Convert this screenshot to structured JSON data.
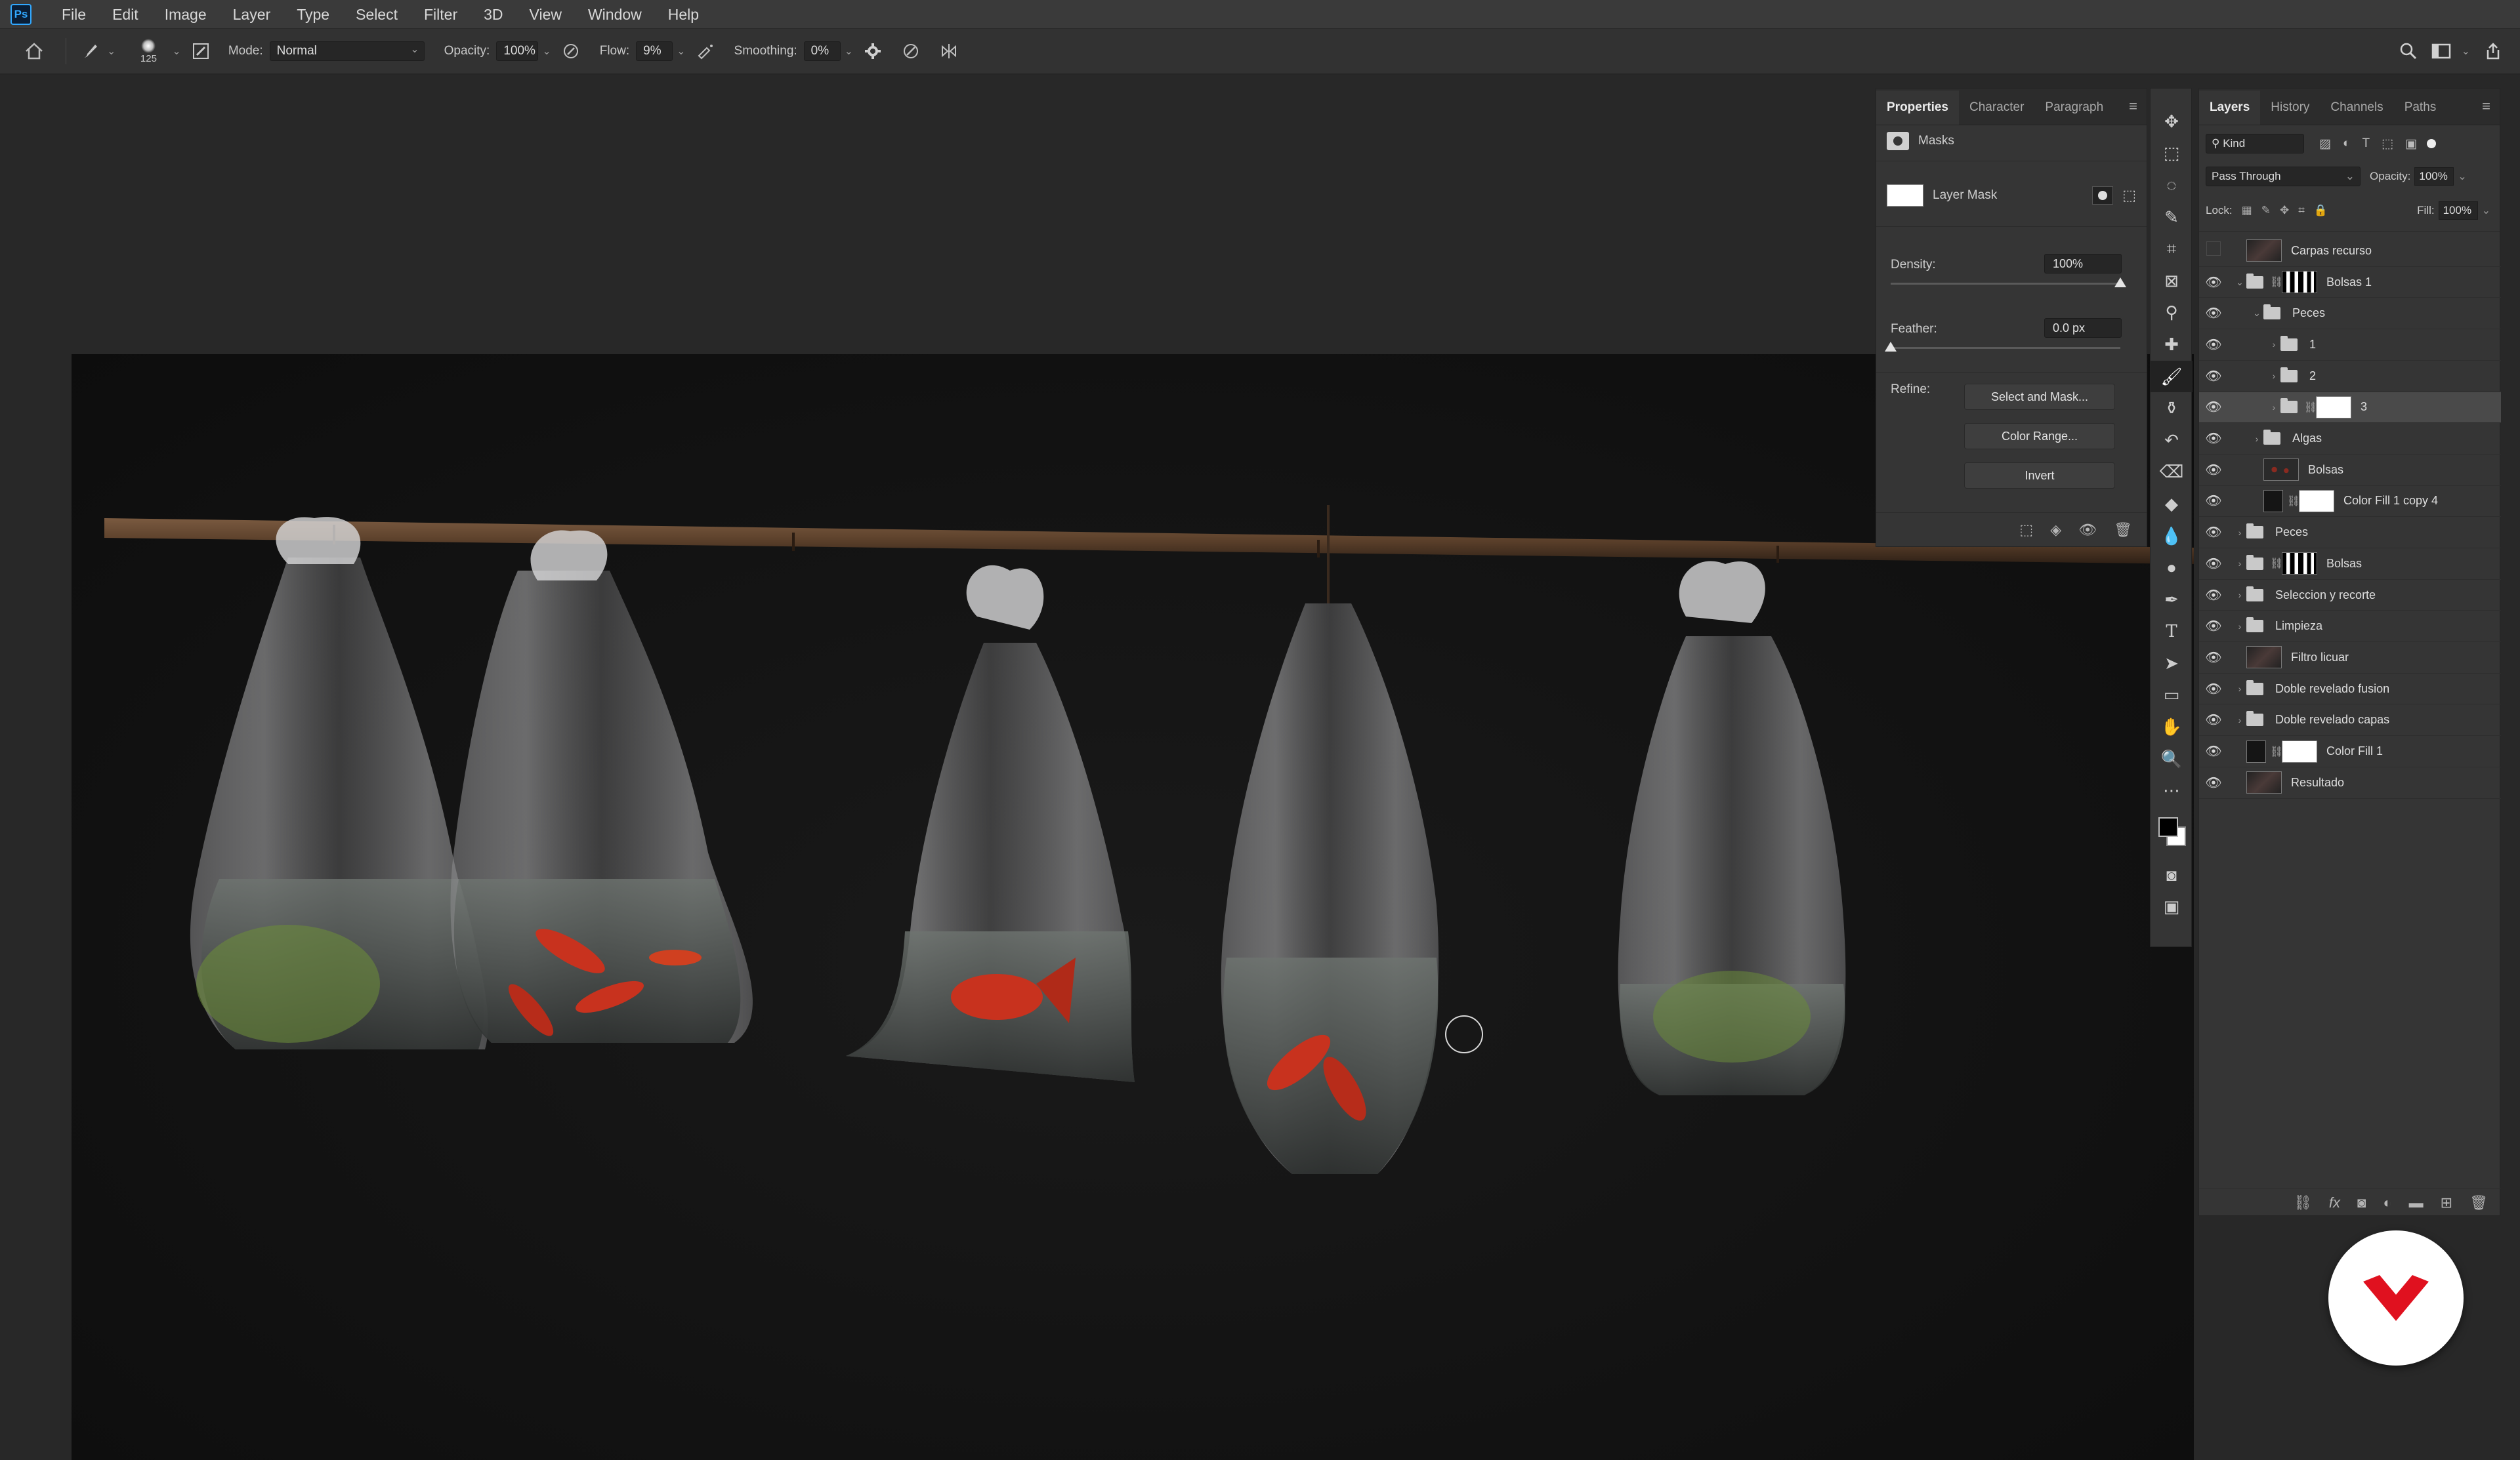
{
  "app": {
    "logo": "Ps"
  },
  "menu": [
    "File",
    "Edit",
    "Image",
    "Layer",
    "Type",
    "Select",
    "Filter",
    "3D",
    "View",
    "Window",
    "Help"
  ],
  "options": {
    "brush_size": "125",
    "mode_label": "Mode:",
    "mode_value": "Normal",
    "opacity_label": "Opacity:",
    "opacity_value": "100%",
    "flow_label": "Flow:",
    "flow_value": "9%",
    "smoothing_label": "Smoothing:",
    "smoothing_value": "0%"
  },
  "properties": {
    "tabs": [
      "Properties",
      "Character",
      "Paragraph"
    ],
    "section": "Masks",
    "mask_label": "Layer Mask",
    "density_label": "Density:",
    "density_value": "100%",
    "density_level": 1.0,
    "feather_label": "Feather:",
    "feather_value": "0.0 px",
    "feather_level": 0.0,
    "refine_label": "Refine:",
    "buttons": [
      "Select and Mask...",
      "Color Range...",
      "Invert"
    ]
  },
  "toolbar": {
    "tools": [
      "move-tool-icon",
      "marquee-tool-icon",
      "lasso-tool-icon",
      "quick-select-tool-icon",
      "crop-tool-icon",
      "frame-tool-icon",
      "eyedropper-tool-icon",
      "healing-brush-tool-icon",
      "brush-tool-icon",
      "clone-stamp-tool-icon",
      "history-brush-tool-icon",
      "eraser-tool-icon",
      "paint-bucket-tool-icon",
      "blur-tool-icon",
      "dodge-tool-icon",
      "pen-tool-icon",
      "type-tool-icon",
      "path-select-tool-icon",
      "rectangle-tool-icon",
      "hand-tool-icon",
      "zoom-tool-icon",
      "more-tools-icon"
    ],
    "active_tool": "brush-tool-icon"
  },
  "layers": {
    "tabs": [
      "Layers",
      "History",
      "Channels",
      "Paths"
    ],
    "filter_kind": "Kind",
    "blend_mode": "Pass Through",
    "opacity_label": "Opacity:",
    "opacity_value": "100%",
    "lock_label": "Lock:",
    "fill_label": "Fill:",
    "fill_value": "100%",
    "rows": [
      {
        "name": "Carpas recurso",
        "visible": false,
        "indent": 0,
        "kind": "image",
        "twisty": ""
      },
      {
        "name": "Bolsas 1",
        "visible": true,
        "indent": 0,
        "kind": "group-mask",
        "twisty": "⌄"
      },
      {
        "name": "Peces",
        "visible": true,
        "indent": 1,
        "kind": "group",
        "twisty": "⌄"
      },
      {
        "name": "1",
        "visible": true,
        "indent": 2,
        "kind": "group",
        "twisty": "›"
      },
      {
        "name": "2",
        "visible": true,
        "indent": 2,
        "kind": "group",
        "twisty": "›"
      },
      {
        "name": "3",
        "visible": true,
        "indent": 2,
        "kind": "group-whitemask",
        "twisty": "›",
        "selected": true
      },
      {
        "name": "Algas",
        "visible": true,
        "indent": 1,
        "kind": "group",
        "twisty": "›"
      },
      {
        "name": "Bolsas",
        "visible": true,
        "indent": 1,
        "kind": "smart",
        "twisty": ""
      },
      {
        "name": "Color Fill 1 copy 4",
        "visible": true,
        "indent": 1,
        "kind": "fill",
        "twisty": ""
      },
      {
        "name": "Peces",
        "visible": true,
        "indent": 0,
        "kind": "group",
        "twisty": "›"
      },
      {
        "name": "Bolsas",
        "visible": true,
        "indent": 0,
        "kind": "group-mask",
        "twisty": "›"
      },
      {
        "name": "Seleccion y recorte",
        "visible": true,
        "indent": 0,
        "kind": "group",
        "twisty": "›"
      },
      {
        "name": "Limpieza",
        "visible": true,
        "indent": 0,
        "kind": "group",
        "twisty": "›"
      },
      {
        "name": "Filtro licuar",
        "visible": true,
        "indent": 0,
        "kind": "image",
        "twisty": ""
      },
      {
        "name": "Doble revelado fusion",
        "visible": true,
        "indent": 0,
        "kind": "group",
        "twisty": "›"
      },
      {
        "name": "Doble revelado capas",
        "visible": true,
        "indent": 0,
        "kind": "group",
        "twisty": "›"
      },
      {
        "name": "Color Fill 1",
        "visible": true,
        "indent": 0,
        "kind": "fill",
        "twisty": ""
      },
      {
        "name": "Resultado",
        "visible": true,
        "indent": 0,
        "kind": "image",
        "twisty": ""
      }
    ]
  },
  "colors": {
    "accent": "#31a8ff",
    "brand_red": "#e0111f",
    "canvas_bg": "#111111",
    "water_tint": "#6e7470",
    "fish": "#c8321e",
    "algae": "#6a8a3a",
    "pole": "#5a3f2a"
  }
}
